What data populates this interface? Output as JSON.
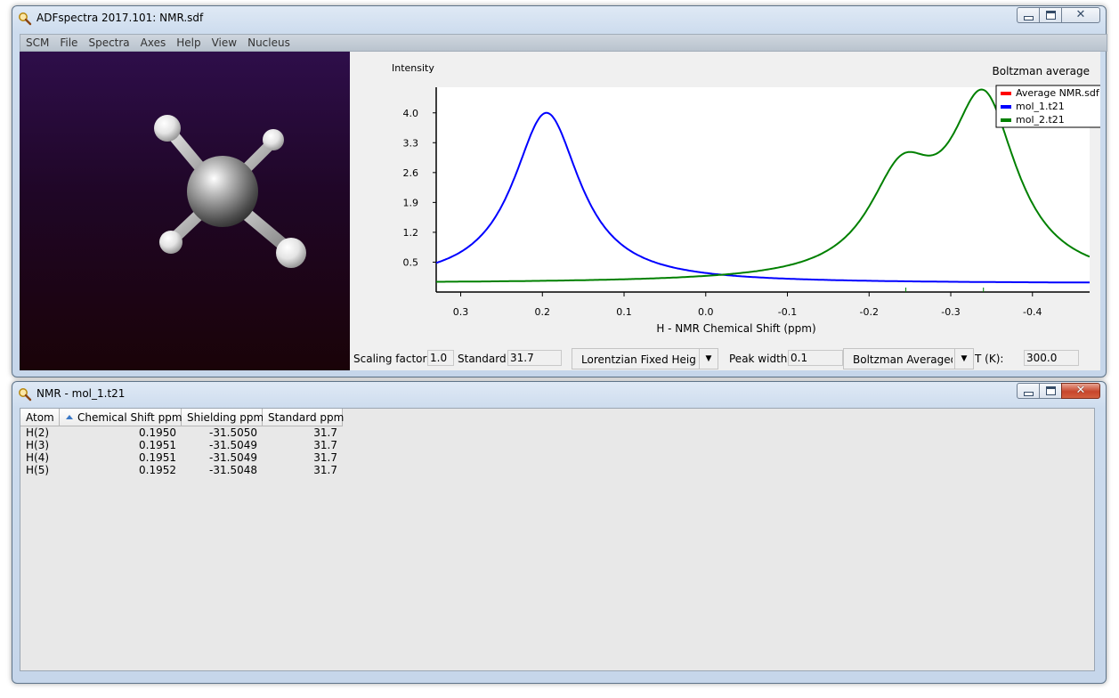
{
  "main_window": {
    "title": "ADFspectra 2017.101: NMR.sdf",
    "menu": [
      "SCM",
      "File",
      "Spectra",
      "Axes",
      "Help",
      "View",
      "Nucleus"
    ]
  },
  "spectrum": {
    "y_axis_label": "Intensity",
    "x_axis_label": "H - NMR Chemical Shift (ppm)",
    "legend_title": "Boltzman average",
    "legend": [
      {
        "label": "Average NMR.sdf",
        "color": "#ff0000"
      },
      {
        "label": "mol_1.t21",
        "color": "#0000ff"
      },
      {
        "label": "mol_2.t21",
        "color": "#008000"
      }
    ],
    "y_ticks": [
      "4.0",
      "3.3",
      "2.6",
      "1.9",
      "1.2",
      "0.5"
    ],
    "x_ticks": [
      "0.3",
      "0.2",
      "0.1",
      "0.0",
      "-0.1",
      "-0.2",
      "-0.3",
      "-0.4"
    ]
  },
  "chart_data": {
    "type": "line",
    "xlabel": "H - NMR Chemical Shift (ppm)",
    "ylabel": "Intensity",
    "title": "",
    "xlim": [
      0.33,
      -0.47
    ],
    "ylim": [
      -0.2,
      4.6
    ],
    "x_reversed": true,
    "grid": false,
    "legend_position": "top-right",
    "series": [
      {
        "name": "mol_1.t21",
        "color": "#0000ff",
        "kind": "lorentzian",
        "peaks": [
          {
            "center": 0.195,
            "height": 4.0,
            "halfwidth": 0.05
          }
        ]
      },
      {
        "name": "mol_2.t21",
        "color": "#008000",
        "kind": "lorentzian",
        "peaks": [
          {
            "center": -0.24,
            "height": 2.2,
            "halfwidth": 0.05
          },
          {
            "center": -0.34,
            "height": 4.1,
            "halfwidth": 0.05
          }
        ]
      }
    ],
    "marker_ticks_ppm": [
      -0.245,
      -0.34
    ]
  },
  "controls": {
    "scaling_factor_label": "Scaling factor:",
    "scaling_factor_value": "1.0",
    "standard_label": "Standard:",
    "standard_value": "31.7",
    "lineshape_value": "Lorentzian Fixed Heigh",
    "peak_width_label": "Peak width:",
    "peak_width_value": "0.1",
    "average_value": "Boltzman Averaged",
    "temperature_label": "T (K):",
    "temperature_value": "300.0"
  },
  "table_window": {
    "title": "NMR - mol_1.t21",
    "columns": [
      "Atom",
      "Chemical Shift ppm",
      "Shielding ppm",
      "Standard ppm"
    ],
    "rows": [
      [
        "H(2)",
        "0.1950",
        "-31.5050",
        "31.7"
      ],
      [
        "H(3)",
        "0.1951",
        "-31.5049",
        "31.7"
      ],
      [
        "H(4)",
        "0.1951",
        "-31.5049",
        "31.7"
      ],
      [
        "H(5)",
        "0.1952",
        "-31.5048",
        "31.7"
      ]
    ]
  }
}
